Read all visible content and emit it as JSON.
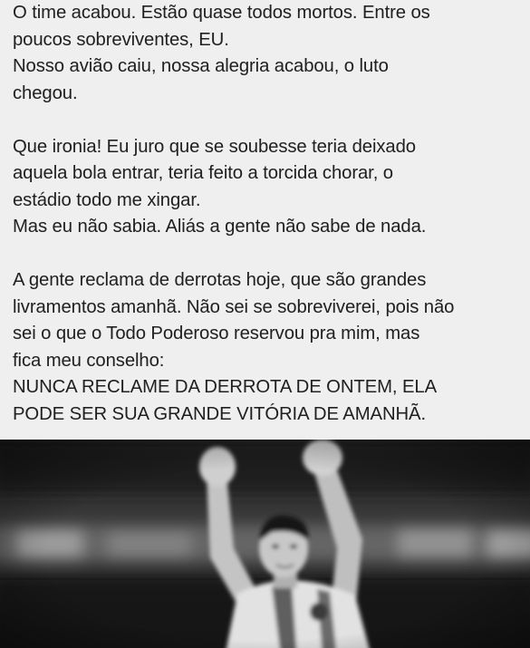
{
  "post": {
    "paragraphs": [
      {
        "lines": [
          "O time acabou. Estão quase todos mortos. Entre os",
          "poucos sobreviventes, EU.",
          "Nosso avião caiu, nossa alegria acabou, o luto",
          "chegou."
        ]
      },
      {
        "lines": [
          "Que ironia! Eu juro que se soubesse teria deixado",
          "aquela bola entrar, teria feito a torcida chorar, o",
          "estádio todo me xingar.",
          "Mas eu não sabia. Aliás a gente não sabe de nada."
        ]
      },
      {
        "lines": [
          "A gente reclama de derrotas hoje, que são grandes",
          "livramentos amanhã. Não sei se sobreviverei, pois não",
          "sei o que o Todo Poderoso reservou pra mim, mas",
          "fica meu conselho:",
          "NUNCA RECLAME DA DERROTA DE ONTEM, ELA",
          "PODE SER SUA GRANDE VITÓRIA DE AMANHÃ."
        ]
      }
    ]
  },
  "photo": {
    "description_icon": "player-celebrating-photo",
    "palette": {
      "background_dark": "#1e1e1e",
      "background_mid": "#5a5a5a",
      "light": "#d8d8d8",
      "skin": "#bdbdbd",
      "shirt": "#e6e6e6",
      "hair": "#141414"
    }
  }
}
